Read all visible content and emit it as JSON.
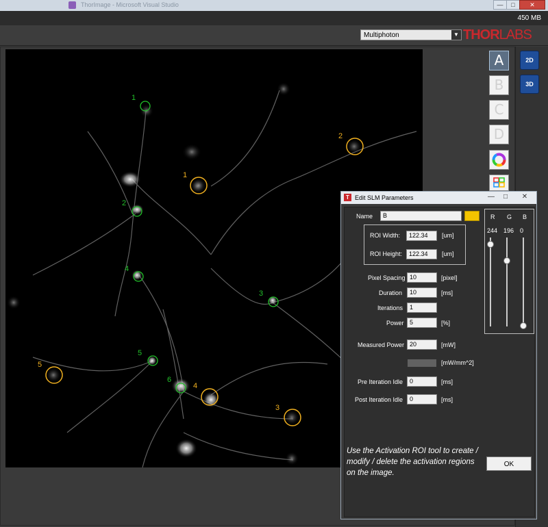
{
  "window": {
    "title": "ThorImage - Microsoft Visual Studio",
    "min_btn": "—",
    "max_btn": "□",
    "close_btn": "✕"
  },
  "status": {
    "memory": "450 MB"
  },
  "toolbar": {
    "modality_selected": "Multiphoton",
    "modality_arrow": "▼",
    "logo_thor": "THOR",
    "logo_labs": "LABS"
  },
  "channels": [
    {
      "label": "A",
      "selected": true
    },
    {
      "label": "B",
      "selected": false
    },
    {
      "label": "C",
      "selected": false
    },
    {
      "label": "D",
      "selected": false
    }
  ],
  "view_buttons": {
    "view_2d": "2D",
    "view_3d": "3D"
  },
  "rois": {
    "green": [
      {
        "label": "1"
      },
      {
        "label": "2"
      },
      {
        "label": "3"
      },
      {
        "label": "4"
      },
      {
        "label": "5"
      },
      {
        "label": "6"
      }
    ],
    "orange": [
      {
        "label": "1"
      },
      {
        "label": "2"
      },
      {
        "label": "3"
      },
      {
        "label": "4"
      },
      {
        "label": "5"
      }
    ],
    "colors": {
      "green": "#22c02a",
      "orange": "#f0b020"
    }
  },
  "dialog": {
    "title": "Edit SLM Parameters",
    "icon_letter": "T",
    "minimize": "—",
    "maximize": "□",
    "close": "✕",
    "name_label": "Name",
    "name_value": "B",
    "name_color": "#f4c400",
    "roi_width_label": "ROI Width:",
    "roi_width_value": "122.34",
    "roi_width_unit": "[um]",
    "roi_height_label": "ROI Height:",
    "roi_height_value": "122.34",
    "roi_height_unit": "[um]",
    "pixel_spacing_label": "Pixel Spacing",
    "pixel_spacing_value": "10",
    "pixel_spacing_unit": "[pixel]",
    "duration_label": "Duration",
    "duration_value": "10",
    "duration_unit": "[ms]",
    "iterations_label": "Iterations",
    "iterations_value": "1",
    "power_label": "Power",
    "power_value": "5",
    "power_unit": "[%]",
    "measured_power_label": "Measured Power",
    "measured_power_value": "20",
    "measured_power_unit": "[mW]",
    "power_density_unit": "[mW/mm^2]",
    "pre_idle_label": "Pre Iteration Idle",
    "pre_idle_value": "0",
    "pre_idle_unit": "[ms]",
    "post_idle_label": "Post Iteration Idle",
    "post_idle_value": "0",
    "post_idle_unit": "[ms]",
    "rgb": {
      "r_label": "R",
      "g_label": "G",
      "b_label": "B",
      "r_value": "244",
      "g_value": "196",
      "b_value": "0",
      "r_level": 0.957,
      "g_level": 0.769,
      "b_level": 0.0
    },
    "help_text": "Use the Activation ROI tool to create / modify / delete the activation regions on the image.",
    "ok_label": "OK"
  }
}
